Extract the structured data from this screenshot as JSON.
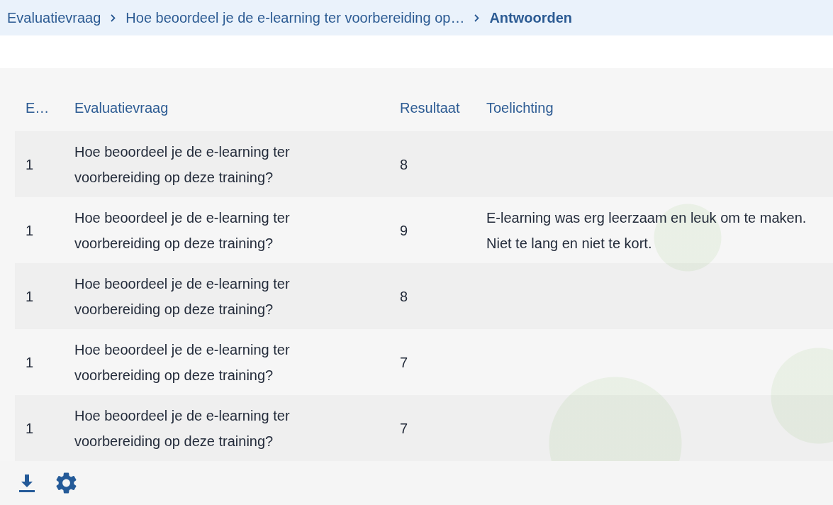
{
  "breadcrumb": [
    {
      "label": "Evaluatievraag",
      "current": false
    },
    {
      "label": "Hoe beoordeel je de e-learning ter voorbereiding op…",
      "current": false
    },
    {
      "label": "Antwoorden",
      "current": true
    }
  ],
  "table": {
    "columns": [
      "E…",
      "Evaluatievraag",
      "Resultaat",
      "Toelichting"
    ],
    "rows": [
      {
        "column_1": "1",
        "evaluatievraag": "Hoe beoordeel je de e-learning ter voorbereiding op deze training?",
        "resultaat": "8"
      },
      {
        "column_1": "1",
        "evaluatievraag": "Hoe beoordeel je de e-learning ter voorbereiding op deze training?",
        "resultaat": "9",
        "toelichting": "E-learning was erg leerzaam en leuk om te maken. Niet te lang en niet te kort."
      },
      {
        "column_1": "1",
        "evaluatievraag": "Hoe beoordeel je de e-learning ter voorbereiding op deze training?",
        "resultaat": "8"
      },
      {
        "column_1": "1",
        "evaluatievraag": "Hoe beoordeel je de e-learning ter voorbereiding op deze training?",
        "resultaat": "7"
      },
      {
        "column_1": "1",
        "evaluatievraag": "Hoe beoordeel je de e-learning ter voorbereiding op deze training?",
        "resultaat": "7"
      }
    ]
  }
}
